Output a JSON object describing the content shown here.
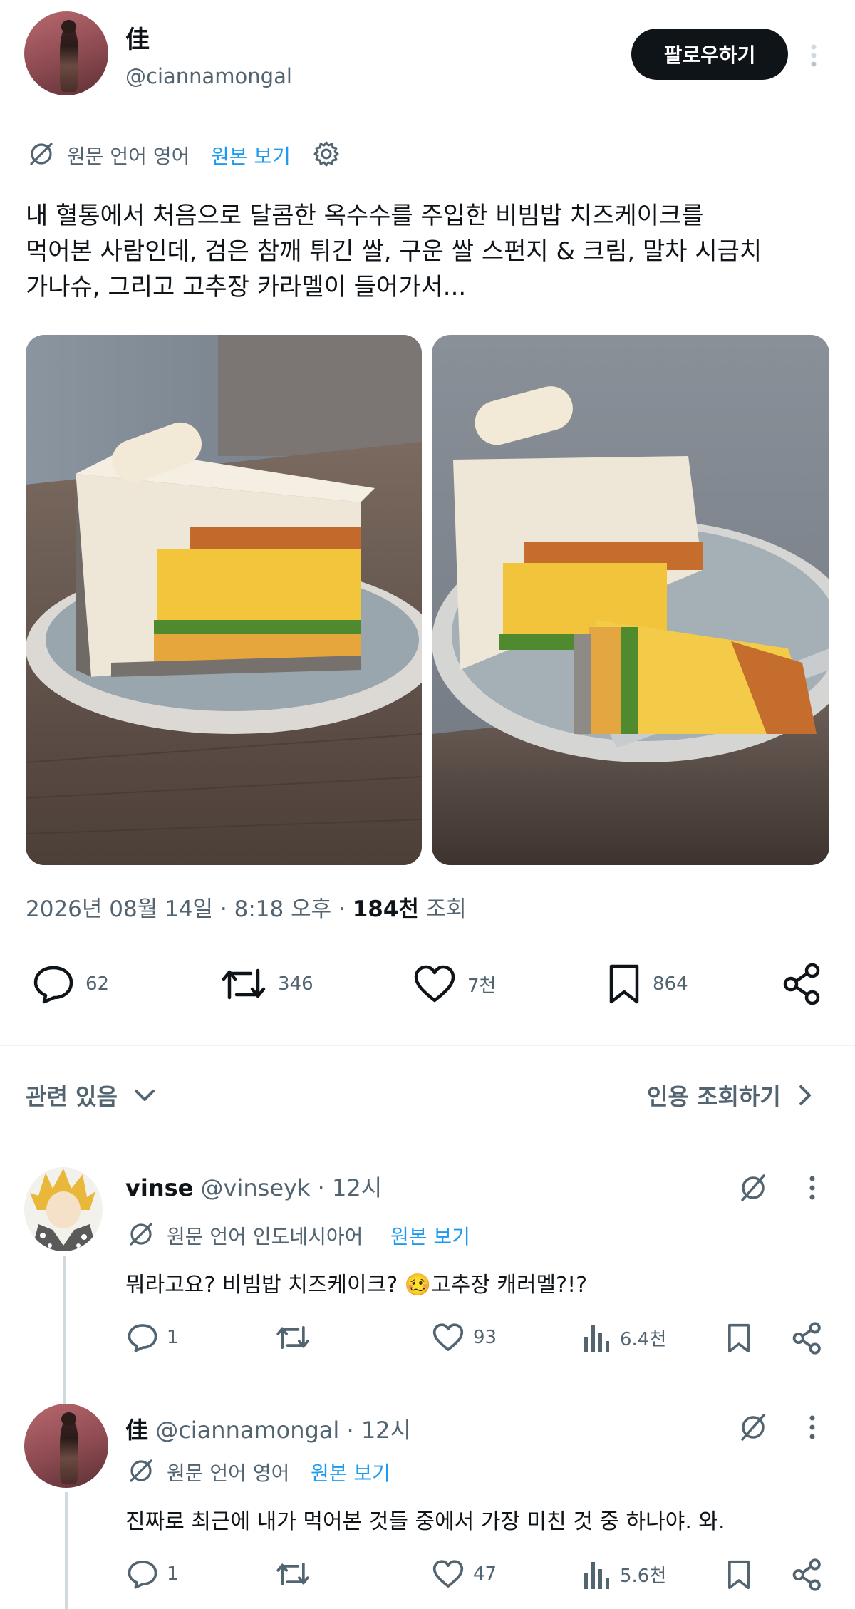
{
  "post": {
    "display_name": "佳",
    "handle": "@ciannamongal",
    "follow_label": "팔로우하기",
    "translate": {
      "label": "원문 언어 영어",
      "show_original": "원본 보기"
    },
    "text_lines": [
      "내 혈통에서 처음으로 달콤한 옥수수를 주입한 비빔밥 치즈케이크를",
      "먹어본 사람인데, 검은 참깨 튀긴 쌀, 구운 쌀 스펀지 & 크림, 말차 시금치",
      "가나슈, 그리고 고추장 카라멜이 들어가서..."
    ],
    "meta": {
      "datetime": "2026년 08월 14일 · 8:18 오후 · ",
      "views": "184천",
      "views_label": " 조회"
    },
    "actions": {
      "replies": "62",
      "reposts": "346",
      "likes": "7천",
      "bookmarks": "864"
    }
  },
  "related": {
    "label": "관련 있음",
    "quote_label": "인용 조회하기"
  },
  "replies": [
    {
      "display_name": "vinse",
      "handle": "@vinseyk",
      "time": " · 12시",
      "translate": {
        "label": "원문 언어 인도네시아어",
        "show_original": "원본 보기"
      },
      "text_before": "뭐라고요? 비빔밥 치즈케이크? ",
      "emoji": "🥴",
      "text_after": "고추장 캐러멜?!?",
      "actions": {
        "replies": "1",
        "reposts": "",
        "likes": "93",
        "views": "6.4천"
      }
    },
    {
      "display_name": "佳",
      "handle": "@ciannamongal",
      "time": " · 12시",
      "translate": {
        "label": "원문 언어 영어",
        "show_original": "원본 보기"
      },
      "text": "진짜로 최근에 내가 먹어본 것들 중에서 가장 미친 것 중 하나야. 와.",
      "actions": {
        "replies": "1",
        "reposts": "",
        "likes": "47",
        "views": "5.6천"
      }
    }
  ],
  "colors": {
    "text": "#0f1419",
    "secondary": "#536471",
    "link": "#1d9bf0",
    "follow_bg": "#0f1419",
    "divider": "#eff3f4"
  }
}
